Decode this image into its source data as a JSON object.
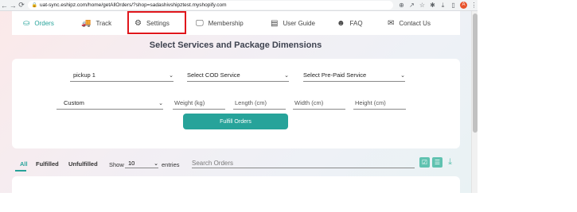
{
  "browser": {
    "url": "uat-sync.eshipz.com/home/getAllOrders/?shop=sadashivshipztest.myshopify.com",
    "avatar_letter": "A"
  },
  "nav": {
    "orders": "Orders",
    "track": "Track",
    "settings": "Settings",
    "membership": "Membership",
    "user_guide": "User Guide",
    "faq": "FAQ",
    "contact_us": "Contact Us"
  },
  "heading": "Select Services and Package Dimensions",
  "form": {
    "pickup": "pickup 1",
    "cod_service": "Select COD Service",
    "prepaid_service": "Select Pre-Paid Service",
    "package": "Custom",
    "weight_placeholder": "Weight (kg)",
    "length_placeholder": "Length (cm)",
    "width_placeholder": "Width (cm)",
    "height_placeholder": "Height (cm)",
    "fulfill_button": "Fulfill Orders"
  },
  "filters": {
    "tab_all": "All",
    "tab_fulfilled": "Fulfilled",
    "tab_unfulfilled": "Unfulfilled",
    "show_label": "Show",
    "show_value": "10",
    "entries_label": "entries",
    "search_placeholder": "Search Orders"
  },
  "colors": {
    "accent": "#27a39a",
    "highlight_box": "#e0161c",
    "tool_icon": "#5fc2b0"
  }
}
